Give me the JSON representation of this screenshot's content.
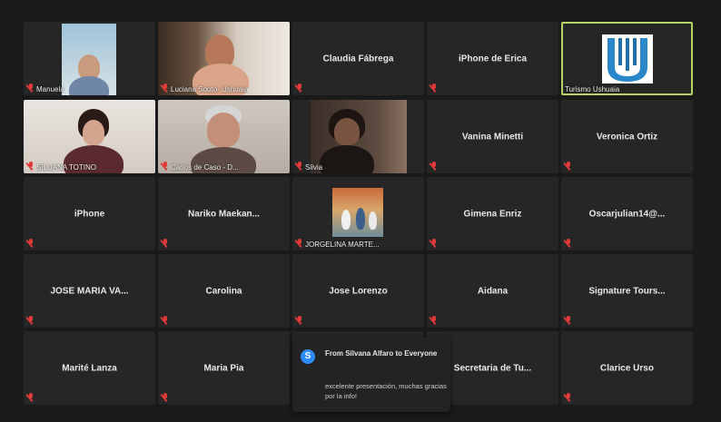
{
  "participants": [
    {
      "name": "Manuela",
      "video": true
    },
    {
      "name": "Luciana Souto- Ushuaia",
      "video": true
    },
    {
      "name": "Claudia Fábrega",
      "video": false
    },
    {
      "name": "iPhone de Erica",
      "video": false
    },
    {
      "name": "Turismo Ushuaia",
      "video": true
    },
    {
      "name": "SILUANA TOTINO",
      "video": true
    },
    {
      "name": "Carlos de Caso - D...",
      "video": true
    },
    {
      "name": "Silvia",
      "video": true
    },
    {
      "name": "Vanina Minetti",
      "video": false
    },
    {
      "name": "Veronica Ortiz",
      "video": false
    },
    {
      "name": "iPhone",
      "video": false
    },
    {
      "name": "Nariko  Maekan...",
      "video": false
    },
    {
      "name": "JORGELINA MARTE...",
      "video": true
    },
    {
      "name": "Gimena Enriz",
      "video": false
    },
    {
      "name": "Oscarjulian14@...",
      "video": false
    },
    {
      "name": "JOSE MARIA VA...",
      "video": false
    },
    {
      "name": "Carolina",
      "video": false
    },
    {
      "name": "Jose Lorenzo",
      "video": false
    },
    {
      "name": "Aidana",
      "video": false
    },
    {
      "name": "Signature  Tours...",
      "video": false
    },
    {
      "name": "Marité Lanza",
      "video": false
    },
    {
      "name": "Maria Pia",
      "video": false
    },
    {
      "name": "",
      "video": false
    },
    {
      "name": "Secretaria  de  Tu...",
      "video": false
    },
    {
      "name": "Clarice Urso",
      "video": false
    }
  ],
  "active_speaker_index": 4,
  "chat_notification": {
    "icon_letter": "S",
    "from": "From Silvana Alfaro to Everyone",
    "message": "excelente presentación, muchas gracias por la info!"
  },
  "colors": {
    "background": "#1a1a1a",
    "tile": "#262626",
    "active_border": "#b8d464",
    "muted_mic": "#e03a3a",
    "chat_accent": "#2d8cff"
  }
}
